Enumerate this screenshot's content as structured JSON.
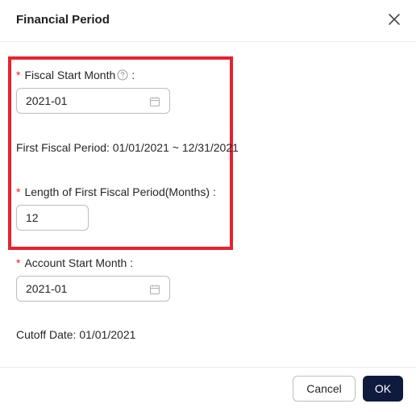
{
  "dialog": {
    "title": "Financial Period"
  },
  "fields": {
    "fiscal_start_month": {
      "required_mark": "*",
      "label": "Fiscal Start Month",
      "colon": ":",
      "value": "2021-01"
    },
    "first_fiscal_period": {
      "text": "First Fiscal Period: 01/01/2021 ~ 12/31/2021"
    },
    "length_first_period": {
      "required_mark": "*",
      "label": "Length of First Fiscal Period(Months)",
      "colon": ":",
      "value": "12"
    },
    "account_start_month": {
      "required_mark": "*",
      "label": "Account Start Month",
      "colon": ":",
      "value": "2021-01"
    },
    "cutoff_date": {
      "text": "Cutoff Date: 01/01/2021"
    }
  },
  "buttons": {
    "cancel": "Cancel",
    "ok": "OK"
  },
  "colors": {
    "required": "#e8212e",
    "highlight": "#e8212e",
    "primary": "#0f1b3d"
  },
  "icons": [
    "close-icon",
    "help-circle-icon",
    "calendar-icon"
  ]
}
